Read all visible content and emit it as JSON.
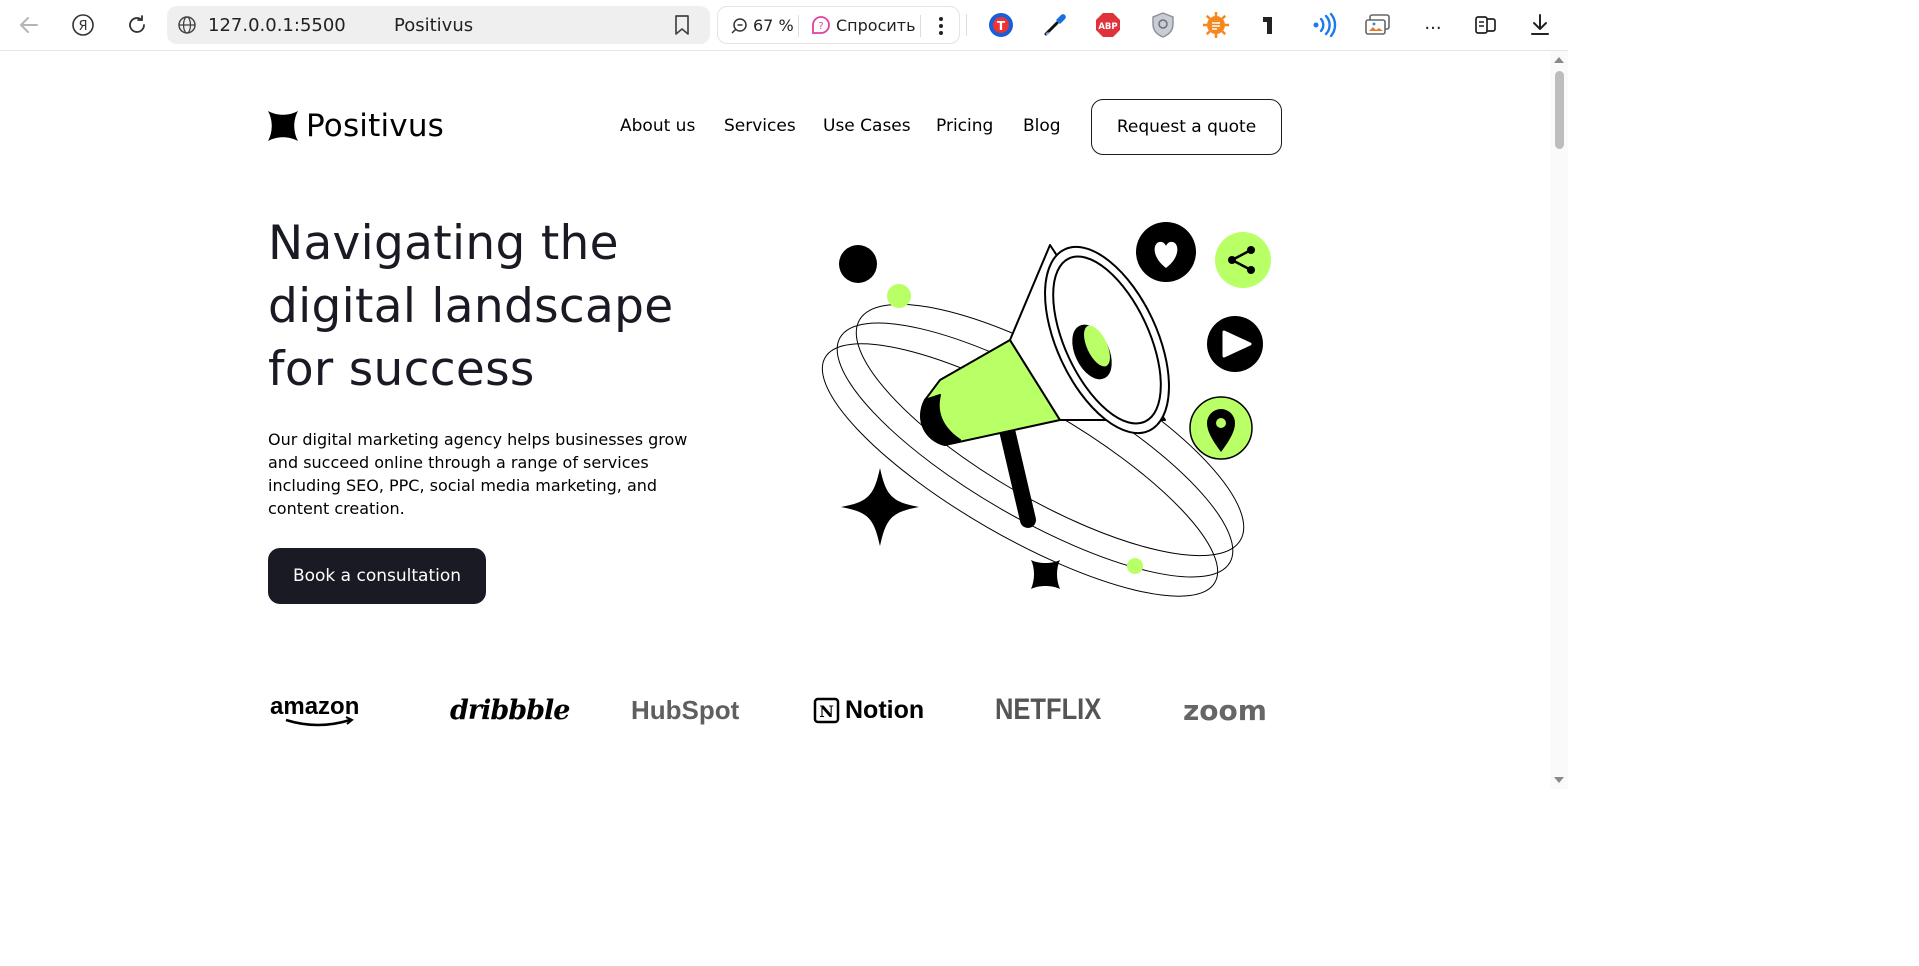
{
  "browser": {
    "url": "127.0.0.1:5500",
    "tab_title": "Positivus",
    "zoom": "67 %",
    "ask_label": "Спросить",
    "more_label": "...",
    "icons": [
      "back-arrow-icon",
      "yandex-icon",
      "reload-icon",
      "globe-icon",
      "bookmark-icon",
      "zoom-icon",
      "ask-icon",
      "kebab-icon",
      "translate-icon",
      "eyedropper-icon",
      "adblock-icon",
      "shield-icon",
      "sun-extension-icon",
      "type-extension-icon",
      "wifi-extension-icon",
      "screenshot-extension-icon",
      "collections-icon",
      "download-icon"
    ]
  },
  "header": {
    "brand": "Positivus",
    "nav": [
      "About us",
      "Services",
      "Use Cases",
      "Pricing",
      "Blog"
    ],
    "quote_button": "Request a quote"
  },
  "hero": {
    "title_lines": [
      "Navigating the",
      "digital landscape",
      "for success"
    ],
    "description_lines": [
      "Our digital marketing agency helps businesses grow",
      "and succeed online through a range of services",
      "including SEO, PPC, social media marketing, and",
      "content creation."
    ],
    "cta_label": "Book a consultation"
  },
  "clients": {
    "logos": [
      "amazon",
      "dribbble",
      "HubSpot",
      "Notion",
      "NETFLIX",
      "zoom"
    ]
  },
  "colors": {
    "accent": "#B9FF66",
    "dark": "#191A23",
    "logo_gray": "#5f5f5f"
  }
}
